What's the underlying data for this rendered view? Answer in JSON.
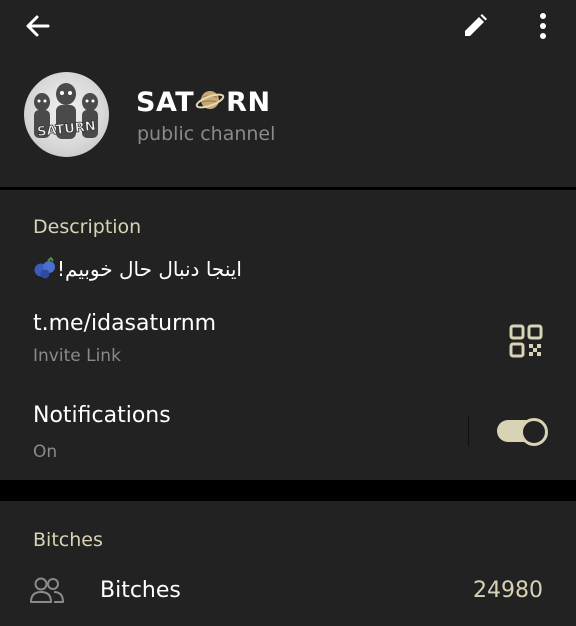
{
  "toolbar": {
    "back_icon": "arrow-left-icon",
    "edit_icon": "pencil-icon",
    "more_icon": "more-vertical-icon"
  },
  "channel": {
    "name_start": "SAT",
    "name_emoji": "🪐",
    "name_end": "RN",
    "type_label": "public channel",
    "avatar_text": "SATURN"
  },
  "description": {
    "title": "Description",
    "text": "اینجا دنبال حال خوبیم!",
    "emoji": "🫐"
  },
  "invite": {
    "link": "t.me/idasaturnm",
    "label": "Invite Link",
    "qr_icon": "qr-code-icon"
  },
  "notifications": {
    "title": "Notifications",
    "status": "On",
    "enabled": true
  },
  "members_section": {
    "title": "Bitches",
    "item_label": "Bitches",
    "count": "24980",
    "icon": "members-icon"
  },
  "colors": {
    "background": "#000000",
    "card": "#222222",
    "accent": "#d8d3b4",
    "secondary_text": "#8a8a8a"
  }
}
